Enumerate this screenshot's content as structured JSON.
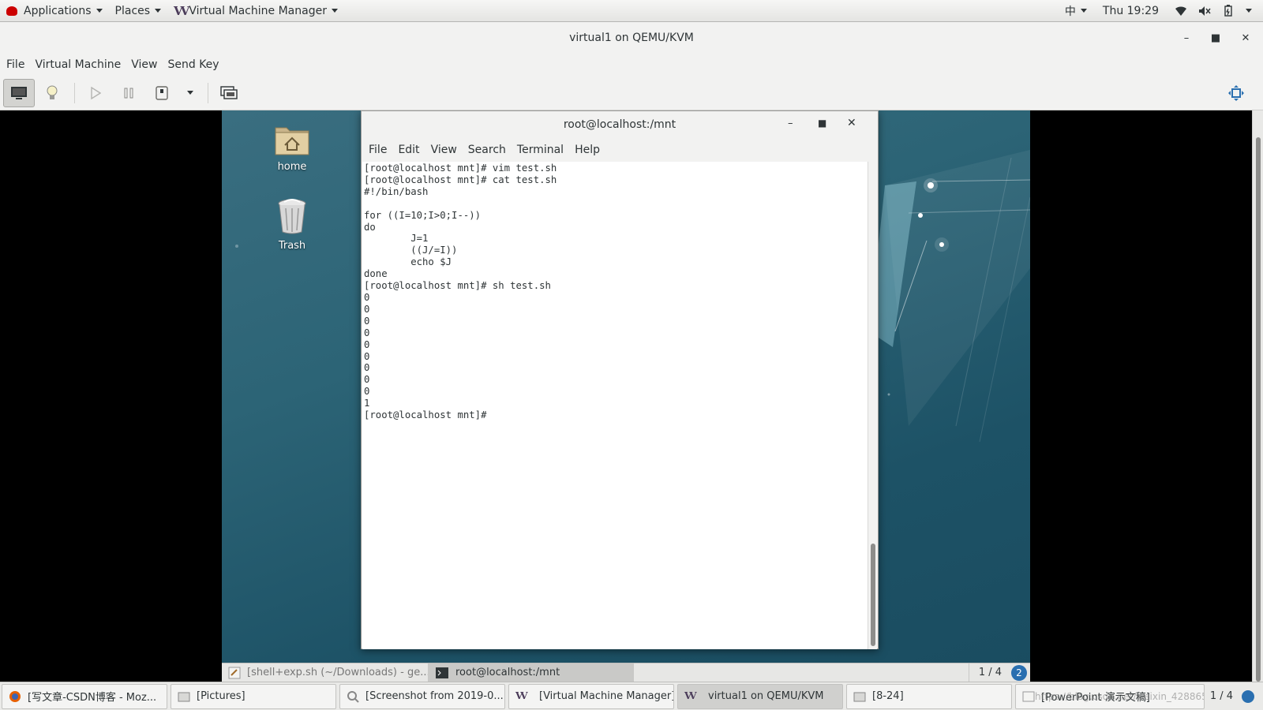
{
  "topbar": {
    "applications": "Applications",
    "places": "Places",
    "app_name": "Virtual Machine Manager",
    "input_method": "中",
    "clock": "Thu 19:29"
  },
  "window": {
    "title": "virtual1 on QEMU/KVM",
    "menu": [
      "File",
      "Virtual Machine",
      "View",
      "Send Key"
    ]
  },
  "desktop": {
    "icons": [
      {
        "label": "home",
        "icon": "home-folder-icon"
      },
      {
        "label": "Trash",
        "icon": "trash-icon"
      }
    ]
  },
  "terminal": {
    "title": "root@localhost:/mnt",
    "menu": [
      "File",
      "Edit",
      "View",
      "Search",
      "Terminal",
      "Help"
    ],
    "lines": [
      "[root@localhost mnt]# vim test.sh",
      "[root@localhost mnt]# cat test.sh",
      "#!/bin/bash",
      "",
      "for ((I=10;I>0;I--))",
      "do",
      "        J=1",
      "        ((J/=I))",
      "        echo $J",
      "done",
      "[root@localhost mnt]# sh test.sh",
      "0",
      "0",
      "0",
      "0",
      "0",
      "0",
      "0",
      "0",
      "0",
      "1",
      "[root@localhost mnt]# "
    ]
  },
  "guest_taskbar": {
    "tasks": [
      {
        "label": "[shell+exp.sh (~/Downloads) - ge...",
        "active": false
      },
      {
        "label": "root@localhost:/mnt",
        "active": true
      }
    ],
    "workspace": "1 / 4",
    "badge": "2"
  },
  "host_taskbar": {
    "tasks": [
      {
        "label": "[写文章-CSDN博客 - Moz...",
        "icon": "firefox-icon",
        "active": false
      },
      {
        "label": "[Pictures]",
        "icon": "folder-icon",
        "active": false
      },
      {
        "label": "[Screenshot from 2019-0...",
        "icon": "image-viewer-icon",
        "active": false
      },
      {
        "label": "[Virtual Machine Manager]",
        "icon": "vmm-icon",
        "active": false
      },
      {
        "label": "virtual1 on QEMU/KVM",
        "icon": "vmm-icon",
        "active": true
      },
      {
        "label": "[8-24]",
        "icon": "folder-icon",
        "active": false
      },
      {
        "label": "[PowerPoint 演示文稿]",
        "icon": "presentation-icon",
        "active": false
      }
    ],
    "workspace": "1 / 4",
    "watermark": "https://blog.csdn.net/weixin_4288658"
  }
}
